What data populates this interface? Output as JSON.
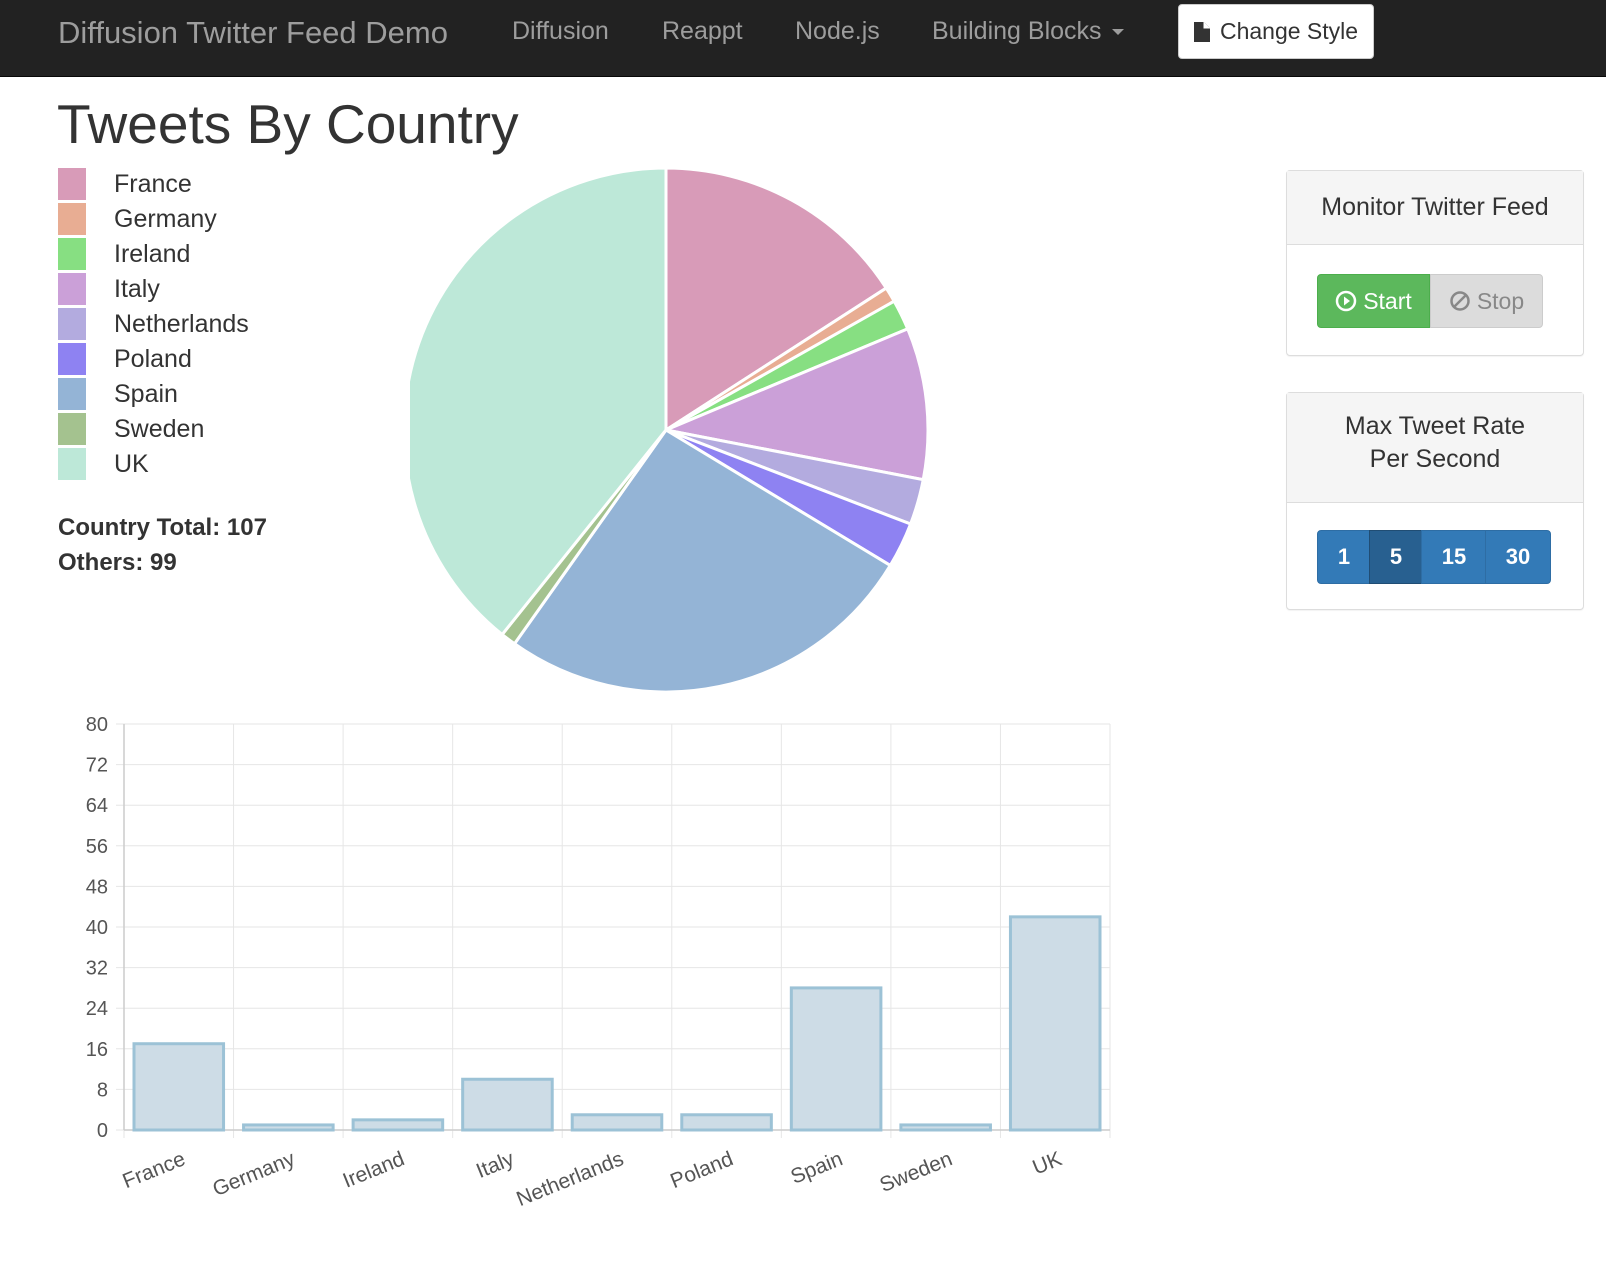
{
  "navbar": {
    "brand": "Diffusion Twitter Feed Demo",
    "links": [
      "Diffusion",
      "Reappt",
      "Node.js",
      "Building Blocks"
    ],
    "style_button": "Change Style"
  },
  "page_title": "Tweets By Country",
  "legend": [
    {
      "label": "France",
      "color": "#d89bb8"
    },
    {
      "label": "Germany",
      "color": "#e8ad93"
    },
    {
      "label": "Ireland",
      "color": "#87df82"
    },
    {
      "label": "Italy",
      "color": "#cba0d8"
    },
    {
      "label": "Netherlands",
      "color": "#b3abdf"
    },
    {
      "label": "Poland",
      "color": "#8e82f2"
    },
    {
      "label": "Spain",
      "color": "#94b4d6"
    },
    {
      "label": "Sweden",
      "color": "#a4c28f"
    },
    {
      "label": "UK",
      "color": "#bde8d8"
    }
  ],
  "stats": {
    "country_total": "Country Total: 107",
    "others": "Others: 99"
  },
  "monitor_panel": {
    "title": "Monitor Twitter Feed",
    "start_label": "Start",
    "stop_label": "Stop"
  },
  "rate_panel": {
    "title_line1": "Max Tweet Rate",
    "title_line2": "Per Second",
    "options": [
      "1",
      "5",
      "15",
      "30"
    ],
    "selected": "5"
  },
  "chart_data": [
    {
      "type": "pie",
      "categories": [
        "France",
        "Germany",
        "Ireland",
        "Italy",
        "Netherlands",
        "Poland",
        "Spain",
        "Sweden",
        "UK"
      ],
      "values": [
        17,
        1,
        2,
        10,
        3,
        3,
        28,
        1,
        42
      ],
      "colors": [
        "#d89bb8",
        "#e8ad93",
        "#87df82",
        "#cba0d8",
        "#b3abdf",
        "#8e82f2",
        "#94b4d6",
        "#a4c28f",
        "#bde8d8"
      ]
    },
    {
      "type": "bar",
      "categories": [
        "France",
        "Germany",
        "Ireland",
        "Italy",
        "Netherlands",
        "Poland",
        "Spain",
        "Sweden",
        "UK"
      ],
      "values": [
        17,
        1,
        2,
        10,
        3,
        3,
        28,
        1,
        42
      ],
      "ylim": [
        0,
        80
      ],
      "yticks": [
        0,
        8,
        16,
        24,
        32,
        40,
        48,
        56,
        64,
        72,
        80
      ],
      "grid": true,
      "bar_fill": "#cddce6",
      "bar_stroke": "#9cc2d6"
    }
  ]
}
